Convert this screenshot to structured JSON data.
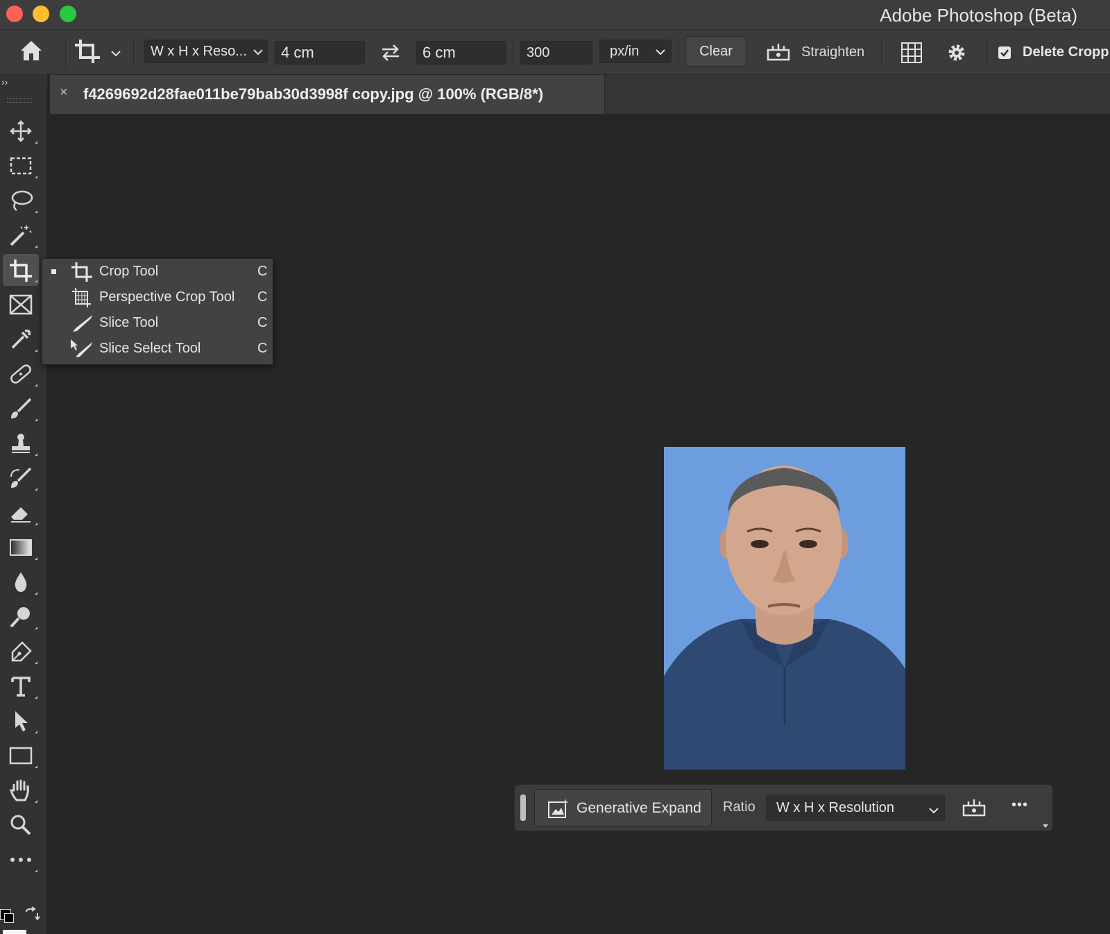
{
  "window": {
    "title": "Adobe Photoshop (Beta)"
  },
  "options_bar": {
    "ratio_preset": "W x H x Reso...",
    "width_value": "4 cm",
    "height_value": "6 cm",
    "resolution_value": "300",
    "resolution_unit": "px/in",
    "clear_label": "Clear",
    "straighten_label": "Straighten",
    "delete_cropped_label": "Delete Cropp",
    "delete_cropped_checked": true
  },
  "panel_collapse": "››",
  "document_tab": {
    "close_glyph": "×",
    "title": "f4269692d28fae011be79bab30d3998f copy.jpg @ 100% (RGB/8*)"
  },
  "tools_flyout": {
    "items": [
      {
        "label": "Crop Tool",
        "shortcut": "C",
        "selected": true,
        "icon": "crop-icon"
      },
      {
        "label": "Perspective Crop Tool",
        "shortcut": "C",
        "selected": false,
        "icon": "perspective-crop-icon"
      },
      {
        "label": "Slice Tool",
        "shortcut": "C",
        "selected": false,
        "icon": "slice-icon"
      },
      {
        "label": "Slice Select Tool",
        "shortcut": "C",
        "selected": false,
        "icon": "slice-select-icon"
      }
    ]
  },
  "contextual_taskbar": {
    "generative_expand_label": "Generative Expand",
    "ratio_label": "Ratio",
    "ratio_value": "W x H x Resolution",
    "more_glyph": "•••"
  },
  "colors": {
    "photo_background": "#6b9ddf",
    "canvas": "#262626",
    "panel": "#323232"
  }
}
